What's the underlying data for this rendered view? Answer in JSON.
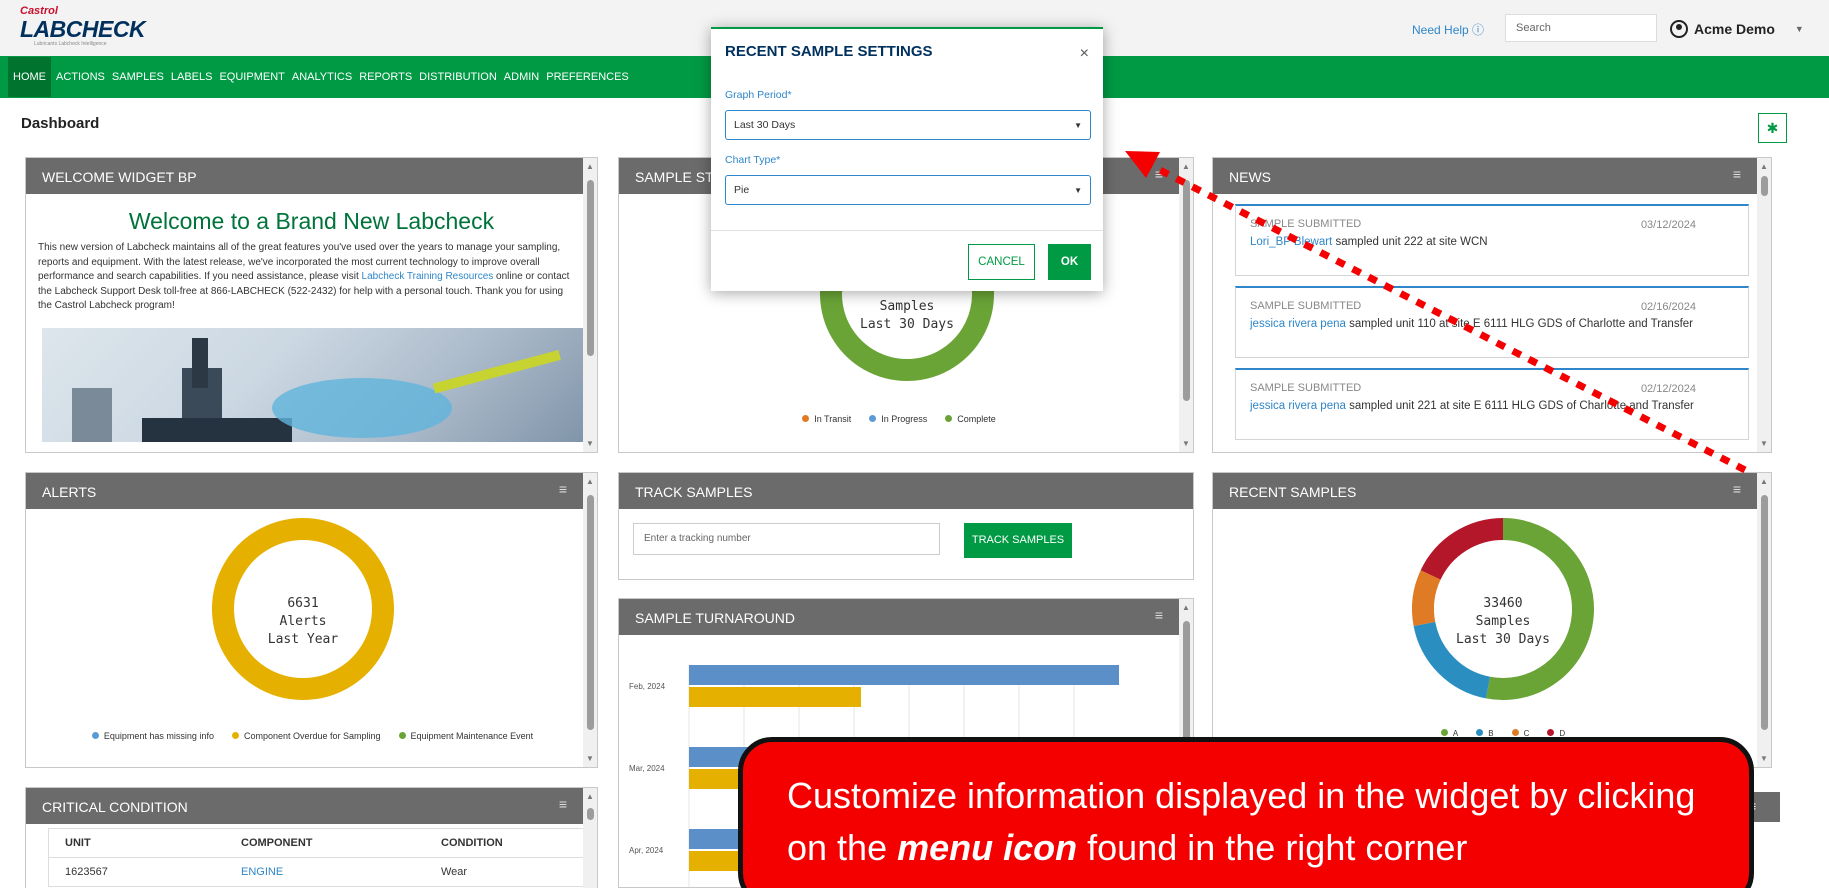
{
  "header": {
    "brand_top": "Castrol",
    "brand_name": "LABCHECK",
    "brand_tag": "Lubricants Labcheck Intelligence",
    "help_label": "Need Help",
    "search_placeholder": "Search",
    "user_name": "Acme Demo"
  },
  "nav": [
    "HOME",
    "ACTIONS",
    "SAMPLES",
    "LABELS",
    "EQUIPMENT",
    "ANALYTICS",
    "REPORTS",
    "DISTRIBUTION",
    "ADMIN",
    "PREFERENCES"
  ],
  "page_title": "Dashboard",
  "welcome": {
    "header": "WELCOME WIDGET BP",
    "heading": "Welcome to a Brand New Labcheck",
    "body_pre": "This new version of Labcheck maintains all of the great features you've used over the years to manage your sampling, reports and equipment. With the latest release, we've incorporated the most current technology to improve overall performance and search capabilities. If you need assistance, please visit",
    "link": "Labcheck Training Resources",
    "body_post": "online or contact the Labcheck Support Desk toll-free at 866-LABCHECK (522-2432) for help with a personal touch. Thank you for using the Castrol Labcheck program!"
  },
  "sample_status": {
    "header": "SAMPLE ST",
    "center_line1": "Samples",
    "center_line2": "Last 30 Days",
    "legend": [
      {
        "label": "In Transit",
        "color": "#e07b25"
      },
      {
        "label": "In Progress",
        "color": "#5b9bd5"
      },
      {
        "label": "Complete",
        "color": "#6aa437"
      }
    ]
  },
  "news": {
    "header": "NEWS",
    "items": [
      {
        "kind": "SAMPLE SUBMITTED",
        "date": "03/12/2024",
        "user": "Lori_BP Blewart",
        "text": "sampled unit 222 at site WCN"
      },
      {
        "kind": "SAMPLE SUBMITTED",
        "date": "02/16/2024",
        "user": "jessica rivera pena",
        "text": "sampled unit 110 at site E 6111 HLG GDS of Charlotte and Transfer"
      },
      {
        "kind": "SAMPLE SUBMITTED",
        "date": "02/12/2024",
        "user": "jessica rivera pena",
        "text": "sampled unit 221 at site E 6111 HLG GDS of Charlotte and Transfer"
      }
    ]
  },
  "alerts": {
    "header": "ALERTS",
    "center_value": "6631",
    "center_line2": "Alerts",
    "center_line3": "Last Year",
    "legend": [
      {
        "label": "Equipment has missing info",
        "color": "#5b9bd5"
      },
      {
        "label": "Component Overdue for Sampling",
        "color": "#e6b000"
      },
      {
        "label": "Equipment Maintenance Event",
        "color": "#6aa437"
      }
    ]
  },
  "track": {
    "header": "TRACK SAMPLES",
    "input_placeholder": "Enter a tracking number",
    "button_label": "TRACK SAMPLES"
  },
  "recent": {
    "header": "RECENT SAMPLES",
    "center_value": "33460",
    "center_line2": "Samples",
    "center_line3": "Last 30 Days",
    "legend": [
      {
        "label": "A",
        "color": "#6aa437"
      },
      {
        "label": "B",
        "color": "#2a8fc0"
      },
      {
        "label": "C",
        "color": "#e07b25"
      },
      {
        "label": "D",
        "color": "#b5172a"
      }
    ]
  },
  "turnaround": {
    "header": "SAMPLE TURNAROUND"
  },
  "critical": {
    "header": "CRITICAL CONDITION",
    "columns": [
      "UNIT",
      "COMPONENT",
      "CONDITION"
    ],
    "rows": [
      [
        "1623567",
        "ENGINE",
        "Wear"
      ]
    ]
  },
  "modal": {
    "title": "RECENT SAMPLE SETTINGS",
    "period_label": "Graph Period*",
    "period_value": "Last 30 Days",
    "type_label": "Chart Type*",
    "type_value": "Pie",
    "cancel": "CANCEL",
    "ok": "OK"
  },
  "callout": {
    "text_pre": "Customize information displayed in the widget by clicking on the",
    "text_em": "menu icon",
    "text_post": "found in the right corner"
  },
  "chart_data": [
    {
      "type": "pie",
      "title": "Sample Status",
      "categories": [
        "In Transit",
        "In Progress",
        "Complete"
      ],
      "values": [
        2,
        0,
        98
      ]
    },
    {
      "type": "pie",
      "title": "Alerts",
      "categories": [
        "Equipment has missing info",
        "Component Overdue for Sampling",
        "Equipment Maintenance Event"
      ],
      "values": [
        0,
        100,
        0
      ]
    },
    {
      "type": "pie",
      "title": "Recent Samples",
      "categories": [
        "A",
        "B",
        "C",
        "D"
      ],
      "values": [
        53,
        19,
        10,
        18
      ]
    },
    {
      "type": "bar",
      "title": "Sample Turnaround",
      "categories": [
        "Feb, 2024",
        "Mar, 2024",
        "Apr, 2024"
      ],
      "series": [
        {
          "values": [
            100,
            40
          ]
        },
        {
          "values": [
            70,
            30
          ]
        },
        {
          "values": [
            60,
            25
          ]
        }
      ]
    }
  ]
}
